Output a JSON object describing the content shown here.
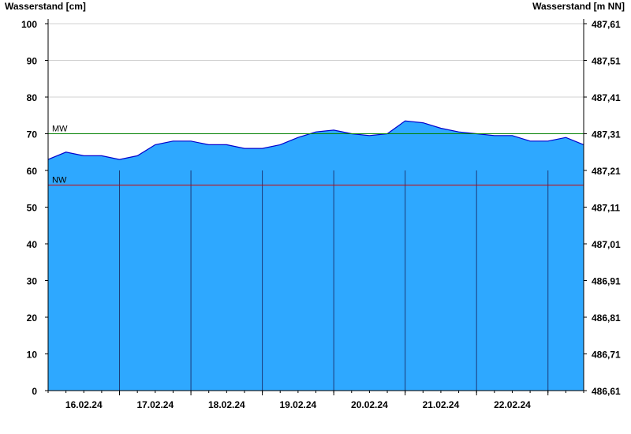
{
  "chart_data": {
    "type": "area",
    "ylabel_left": "Wasserstand [cm]",
    "ylabel_right": "Wasserstand [m NN]",
    "ylim": [
      0,
      100
    ],
    "yticks_left": [
      "0",
      "10",
      "20",
      "30",
      "40",
      "50",
      "60",
      "70",
      "80",
      "90",
      "100"
    ],
    "yticks_right": [
      "486,61",
      "486,71",
      "486,81",
      "486,91",
      "487,01",
      "487,11",
      "487,21",
      "487,31",
      "487,41",
      "487,51",
      "487,61"
    ],
    "x_range": [
      "15.02.24 12:00",
      "23.02.24 00:00"
    ],
    "day_boundaries": [
      "16.02.24 12:00",
      "17.02.24 12:00",
      "18.02.24 12:00",
      "19.02.24 12:00",
      "20.02.24 12:00",
      "21.02.24 12:00",
      "22.02.24 12:00"
    ],
    "xtick_labels": [
      "16.02.24",
      "17.02.24",
      "18.02.24",
      "19.02.24",
      "20.02.24",
      "21.02.24",
      "22.02.24"
    ],
    "reference_lines": [
      {
        "label": "MW",
        "value": 70,
        "color": "#008000"
      },
      {
        "label": "NW",
        "value": 56,
        "color": "#cc0000"
      }
    ],
    "grid": true,
    "colors": {
      "fill": "#2ea8ff",
      "line": "#0000cc",
      "gridline": "#d0d0d0",
      "day_line": "#1a3a7a"
    },
    "series": [
      {
        "x": [
          "15.02.24 12:00",
          "15.02.24 18:00",
          "16.02.24 00:00",
          "16.02.24 06:00",
          "16.02.24 12:00",
          "16.02.24 18:00",
          "17.02.24 00:00",
          "17.02.24 06:00",
          "17.02.24 12:00",
          "17.02.24 18:00",
          "18.02.24 00:00",
          "18.02.24 06:00",
          "18.02.24 12:00",
          "18.02.24 18:00",
          "19.02.24 00:00",
          "19.02.24 06:00",
          "19.02.24 12:00",
          "19.02.24 18:00",
          "20.02.24 00:00",
          "20.02.24 06:00",
          "20.02.24 12:00",
          "20.02.24 18:00",
          "21.02.24 00:00",
          "21.02.24 06:00",
          "21.02.24 12:00",
          "21.02.24 18:00",
          "22.02.24 00:00",
          "22.02.24 06:00",
          "22.02.24 12:00",
          "22.02.24 18:00",
          "23.02.24 00:00"
        ],
        "values": [
          63,
          65,
          64,
          64,
          63,
          64,
          67,
          68,
          68,
          67,
          67,
          66,
          66,
          67,
          69,
          70.5,
          71,
          70,
          69.5,
          70,
          73.5,
          73,
          71.5,
          70.5,
          70,
          69.5,
          69.5,
          68,
          68,
          69,
          67
        ]
      }
    ]
  }
}
